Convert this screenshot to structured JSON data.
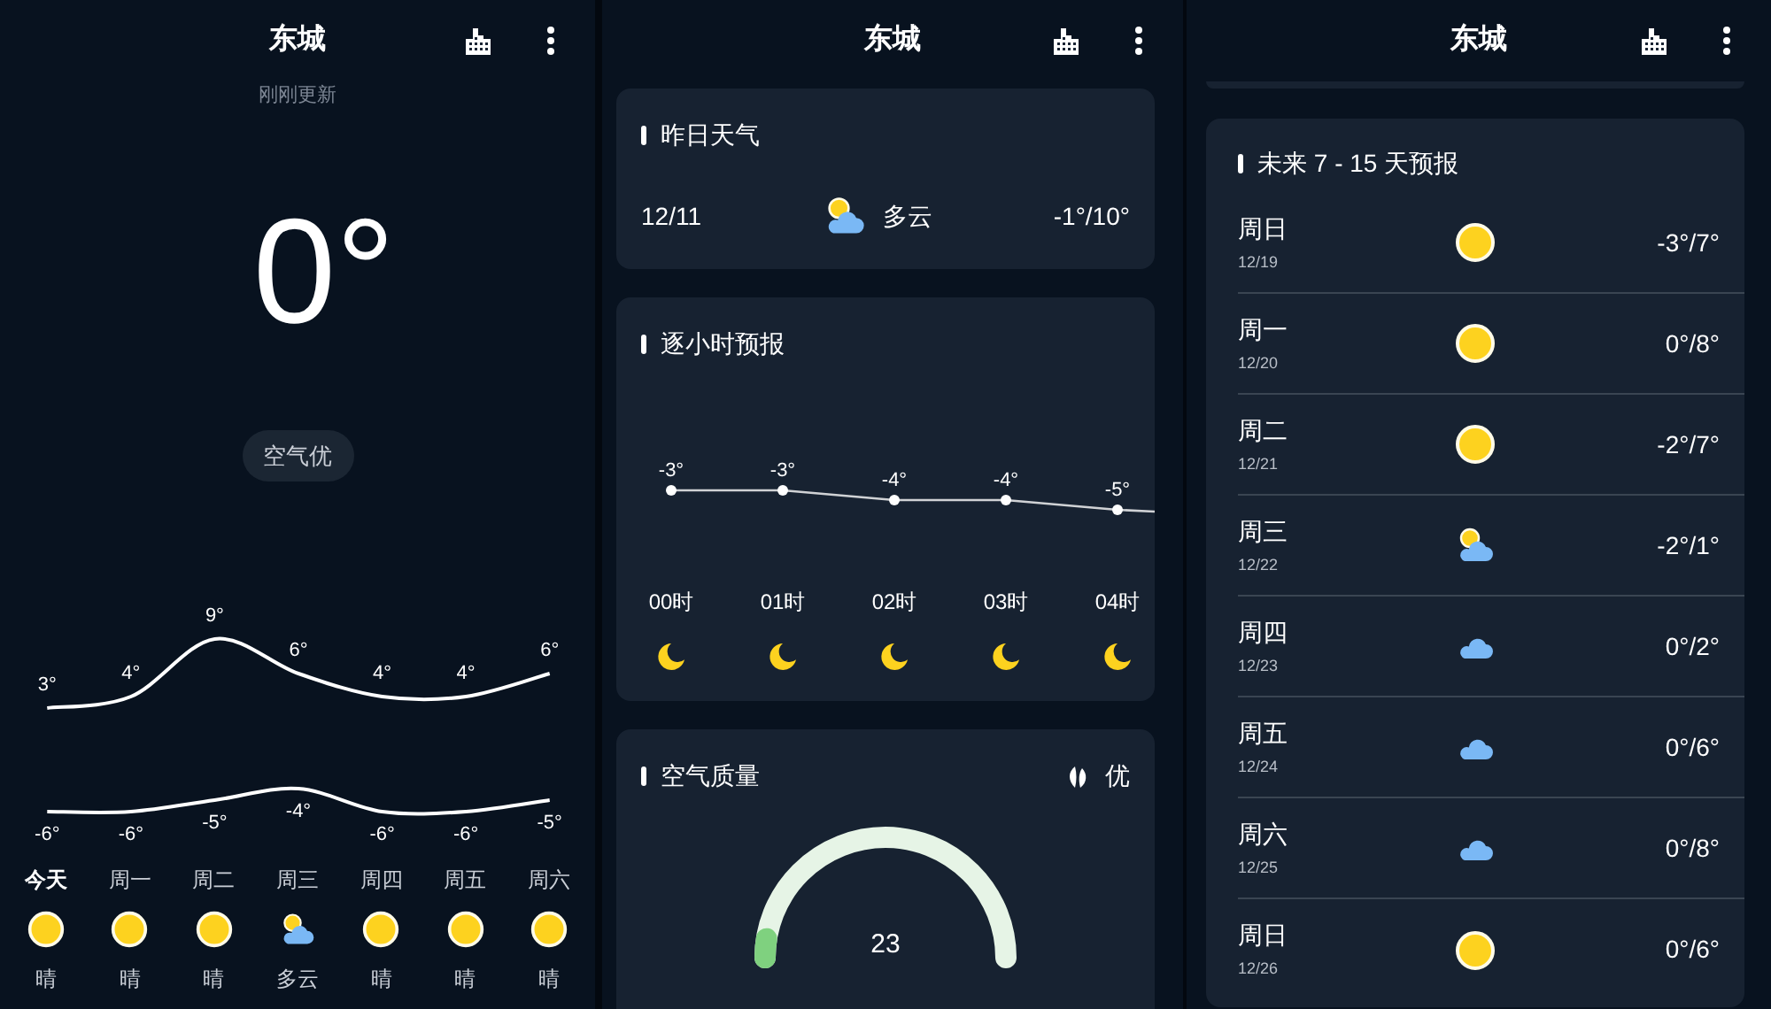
{
  "screens": [
    {
      "header": {
        "title": "东城"
      },
      "updated": "刚刚更新",
      "temperature": "0°",
      "air_badge": "空气优",
      "week_chart": {
        "chart_data": {
          "type": "line",
          "data_labels": true,
          "series": [
            {
              "color": "#ffffff",
              "values": [
                3,
                4,
                9,
                6,
                4,
                4,
                6
              ],
              "value_labels": [
                "3°",
                "4°",
                "9°",
                "6°",
                "4°",
                "4°",
                "6°"
              ]
            },
            {
              "color": "#ffffff",
              "values": [
                -6,
                -6,
                -5,
                -4,
                -6,
                -6,
                -5
              ],
              "value_labels": [
                "-6°",
                "-6°",
                "-5°",
                "-4°",
                "-6°",
                "-6°",
                "-5°"
              ]
            }
          ]
        }
      },
      "days": [
        {
          "label": "今天",
          "selected": true,
          "kind": "sunny",
          "condition": "晴"
        },
        {
          "label": "周一",
          "selected": false,
          "kind": "sunny",
          "condition": "晴"
        },
        {
          "label": "周二",
          "selected": false,
          "kind": "sunny",
          "condition": "晴"
        },
        {
          "label": "周三",
          "selected": false,
          "kind": "partly-cloudy",
          "condition": "多云"
        },
        {
          "label": "周四",
          "selected": false,
          "kind": "sunny",
          "condition": "晴"
        },
        {
          "label": "周五",
          "selected": false,
          "kind": "sunny",
          "condition": "晴"
        },
        {
          "label": "周六",
          "selected": false,
          "kind": "sunny",
          "condition": "晴"
        }
      ]
    },
    {
      "header": {
        "title": "东城"
      },
      "yesterday": {
        "title": "昨日天气",
        "date": "12/11",
        "kind": "partly-cloudy",
        "condition": "多云",
        "range": "-1°/10°"
      },
      "hourly": {
        "title": "逐小时预报",
        "chart_data": {
          "type": "line",
          "data_labels": true,
          "categories": [
            "00时",
            "01时",
            "02时",
            "03时",
            "04时"
          ],
          "series": [
            {
              "color": "#ffffff",
              "marker": "circle",
              "values": [
                -3,
                -3,
                -4,
                -4,
                -5
              ],
              "value_labels": [
                "-3°",
                "-3°",
                "-4°",
                "-4°",
                "-5°"
              ]
            }
          ]
        },
        "icons": [
          {
            "kind": "moon"
          },
          {
            "kind": "moon"
          },
          {
            "kind": "moon"
          },
          {
            "kind": "moon"
          },
          {
            "kind": "moon"
          }
        ]
      },
      "air_quality": {
        "title": "空气质量",
        "grade": "优",
        "value": "23",
        "level": 0.05
      }
    },
    {
      "header": {
        "title": "东城"
      },
      "forecast": {
        "title": "未来 7 - 15 天预报",
        "rows": [
          {
            "day": "周日",
            "date": "12/19",
            "kind": "sunny",
            "range": "-3°/7°"
          },
          {
            "day": "周一",
            "date": "12/20",
            "kind": "sunny",
            "range": "0°/8°"
          },
          {
            "day": "周二",
            "date": "12/21",
            "kind": "sunny",
            "range": "-2°/7°"
          },
          {
            "day": "周三",
            "date": "12/22",
            "kind": "partly-cloudy",
            "range": "-2°/1°"
          },
          {
            "day": "周四",
            "date": "12/23",
            "kind": "cloudy",
            "range": "0°/2°"
          },
          {
            "day": "周五",
            "date": "12/24",
            "kind": "cloudy",
            "range": "0°/6°"
          },
          {
            "day": "周六",
            "date": "12/25",
            "kind": "cloudy",
            "range": "0°/8°"
          },
          {
            "day": "周日",
            "date": "12/26",
            "kind": "sunny",
            "range": "0°/6°"
          }
        ]
      }
    }
  ]
}
